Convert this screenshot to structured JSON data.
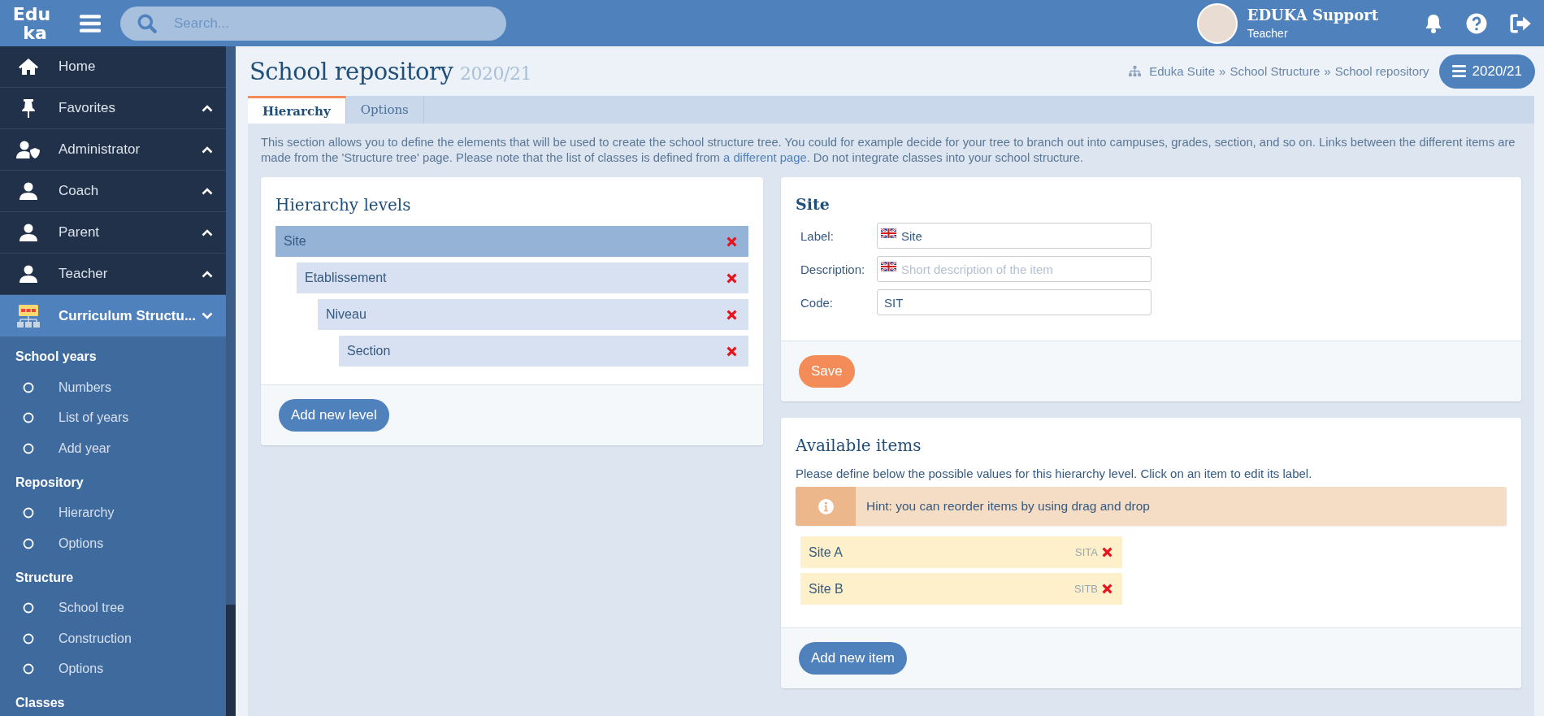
{
  "topbar": {
    "logo_lines": [
      "Edu",
      "ka"
    ],
    "search": {
      "placeholder": "Search..."
    },
    "user": {
      "name": "EDUKA Support",
      "role": "Teacher"
    }
  },
  "sidebar": {
    "menu": [
      {
        "label": "Home",
        "kind": "home",
        "selected": false
      },
      {
        "label": "Favorites",
        "kind": "pin",
        "selected": false,
        "expanded": false
      },
      {
        "label": "Administrator",
        "kind": "admin",
        "selected": false,
        "expanded": false
      },
      {
        "label": "Coach",
        "kind": "person",
        "selected": false,
        "expanded": false
      },
      {
        "label": "Parent",
        "kind": "person",
        "selected": false,
        "expanded": false
      },
      {
        "label": "Teacher",
        "kind": "person",
        "selected": false,
        "expanded": false
      },
      {
        "label": "Curriculum Structu...",
        "kind": "structure",
        "selected": true,
        "expanded": true
      }
    ],
    "sections": [
      {
        "heading": "School years",
        "items": [
          "Numbers",
          "List of years",
          "Add year"
        ]
      },
      {
        "heading": "Repository",
        "items": [
          "Hierarchy",
          "Options"
        ]
      },
      {
        "heading": "Structure",
        "items": [
          "School tree",
          "Construction",
          "Options"
        ]
      },
      {
        "heading": "Classes"
      }
    ]
  },
  "page": {
    "title": "School repository",
    "year": "2020/21",
    "breadcrumb": [
      "Eduka Suite",
      "School Structure",
      "School repository"
    ],
    "breadcrumb_separator": "»",
    "year_button": "2020/21",
    "tabs": [
      {
        "label": "Hierarchy",
        "selected": true
      },
      {
        "label": "Options",
        "selected": false
      }
    ],
    "intro": {
      "before": "This section allows you to define the elements that will be used to create the school structure tree. You could for example decide for your tree to branch out into campuses, grades, section, and so on. Links between the different items are made from the 'Structure tree' page. Please note that the list of classes is defined from ",
      "link": "a different page",
      "after": ". Do not integrate classes into your school structure."
    },
    "levels": {
      "title": "Hierarchy levels",
      "tree": [
        {
          "label": "Site",
          "selected": true,
          "children": [
            {
              "label": "Etablissement",
              "selected": false,
              "children": [
                {
                  "label": "Niveau",
                  "selected": false,
                  "children": [
                    {
                      "label": "Section",
                      "selected": false
                    }
                  ]
                }
              ]
            }
          ]
        }
      ],
      "add_button": "Add new level"
    },
    "detail": {
      "title": "Site",
      "fields": [
        {
          "label": "Label:",
          "kind": "translatable",
          "value": "Site"
        },
        {
          "label": "Description:",
          "kind": "translatable",
          "placeholder": "Short description of the item"
        },
        {
          "label": "Code:",
          "kind": "plain",
          "value": "SIT"
        }
      ],
      "save_button": "Save"
    },
    "items": {
      "title": "Available items",
      "text": "Please define below the possible values for this hierarchy level. Click on an item to edit its label.",
      "hint": "Hint: you can reorder items by using drag and drop",
      "list": [
        {
          "label": "Site A",
          "code": "SITA"
        },
        {
          "label": "Site B",
          "code": "SITB"
        }
      ],
      "add_button": "Add new item"
    }
  }
}
